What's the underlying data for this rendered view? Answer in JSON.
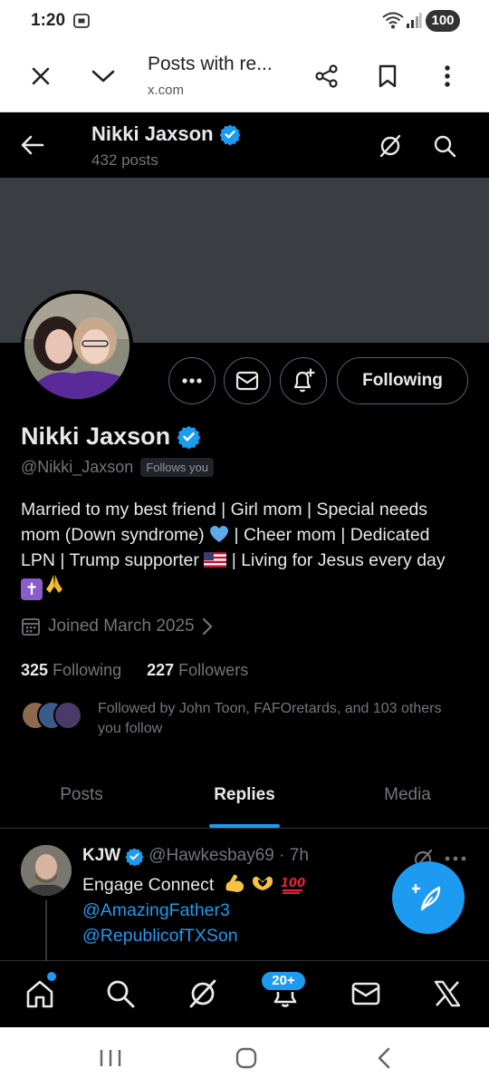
{
  "status_bar": {
    "time": "1:20",
    "battery": "100"
  },
  "browser": {
    "title": "Posts with re...",
    "domain": "x.com"
  },
  "header": {
    "name": "Nikki Jaxson",
    "posts_count": "432 posts"
  },
  "profile": {
    "name": "Nikki Jaxson",
    "handle": "@Nikki_Jaxson",
    "follows_you": "Follows you",
    "following_button": "Following",
    "bio_part1": "Married to my best friend | Girl mom | Special needs mom (Down syndrome) ",
    "bio_part2": " | Cheer mom | Dedicated LPN | Trump supporter ",
    "bio_part3": " | Living for Jesus every day ",
    "joined": "Joined March 2025",
    "following_count": "325",
    "following_label": "Following",
    "followers_count": "227",
    "followers_label": "Followers",
    "followed_by": "Followed by John Toon, FAFOretards, and 103 others you follow"
  },
  "tabs": [
    {
      "label": "Posts"
    },
    {
      "label": "Replies"
    },
    {
      "label": "Media"
    }
  ],
  "post": {
    "name": "KJW",
    "handle_time": "@Hawkesbay69 · 7h",
    "text": "Engage Connect",
    "mention1": "@AmazingFather3",
    "mention2": "@RepublicofTXSon"
  },
  "bottom_nav": {
    "notification_badge": "20+"
  },
  "colors": {
    "accent": "#1d9bf0",
    "background": "#000000",
    "banner": "#3a3e42"
  }
}
